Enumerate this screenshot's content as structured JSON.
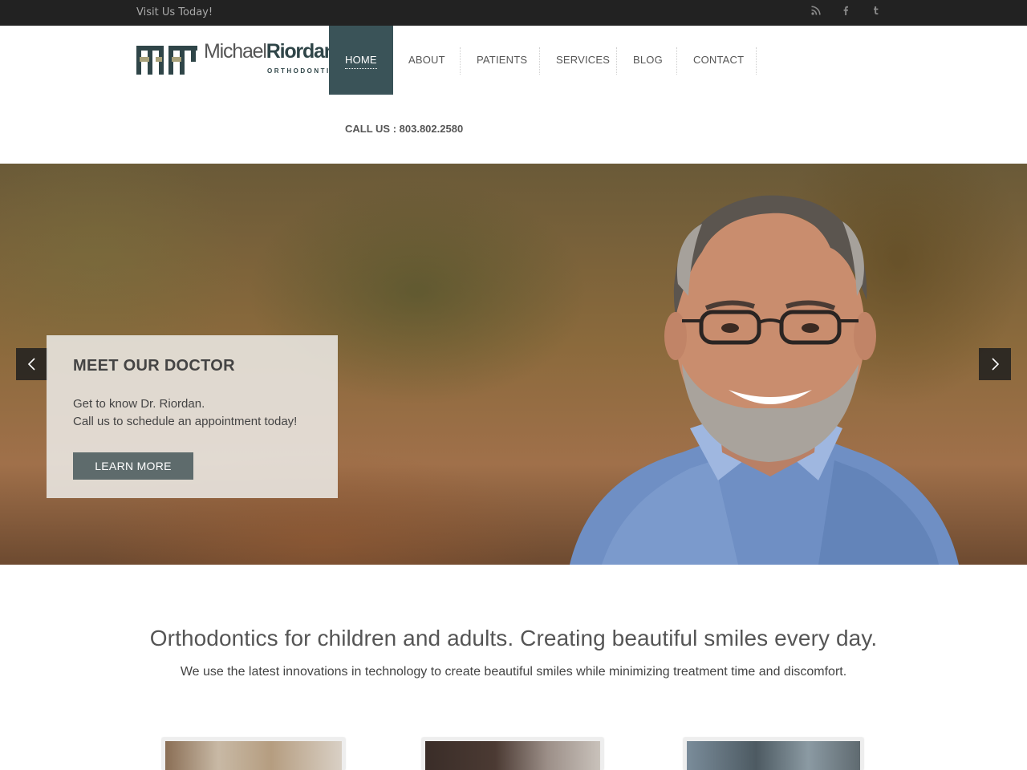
{
  "topbar": {
    "text": "Visit Us Today!",
    "social": [
      "rss-icon",
      "facebook-icon",
      "tumblr-icon"
    ]
  },
  "logo": {
    "name_light": "Michael",
    "name_bold": "Riordan",
    "subtitle": "ORTHODONTIC"
  },
  "nav": {
    "items": [
      {
        "label": "HOME",
        "active": true
      },
      {
        "label": "ABOUT",
        "active": false
      },
      {
        "label": "PATIENTS",
        "active": false
      },
      {
        "label": "SERVICES",
        "active": false
      },
      {
        "label": "BLOG",
        "active": false
      },
      {
        "label": "CONTACT",
        "active": false
      }
    ],
    "call_us": "CALL US : 803.802.2580"
  },
  "hero": {
    "slide": {
      "title": "MEET OUR DOCTOR",
      "line1": "Get to know Dr. Riordan.",
      "line2": "Call us to schedule an appointment today!",
      "button": "LEARN MORE"
    },
    "prev_icon": "chevron-left-icon",
    "next_icon": "chevron-right-icon"
  },
  "intro": {
    "headline": "Orthodontics for children and adults. Creating beautiful smiles every day.",
    "subtext": "We use the latest innovations in technology to create beautiful smiles while minimizing treatment time and discomfort."
  },
  "colors": {
    "topbar": "#222222",
    "nav_active": "#3a5358",
    "button": "#5e6b6c",
    "brand": "#2f4548"
  }
}
